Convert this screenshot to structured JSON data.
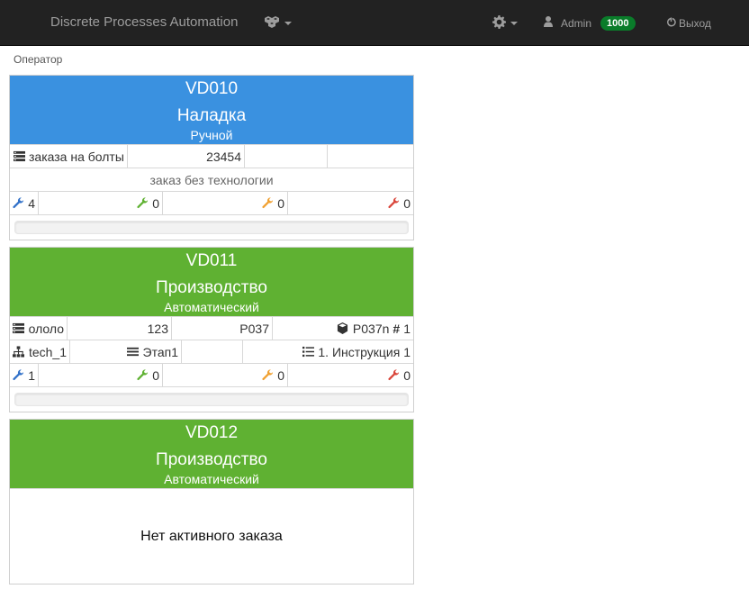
{
  "navbar": {
    "brand": "Discrete Processes Automation",
    "admin_name": "Admin",
    "admin_badge": "1000",
    "logout_label": "Выход"
  },
  "breadcrumb": {
    "label": "Оператор"
  },
  "machines": [
    {
      "id": "VD010",
      "state": "Наладка",
      "mode": "Ручной",
      "header_color": "#3a91e0",
      "order_name": "заказа на болты",
      "order_number": "23454",
      "no_tech_note": "заказ без технологии",
      "tools": {
        "blue": "4",
        "green": "0",
        "orange": "0",
        "red": "0"
      },
      "progress": 0
    },
    {
      "id": "VD011",
      "state": "Производство",
      "mode": "Автоматический",
      "header_color": "#5fb132",
      "order_name": "ололо",
      "order_number": "123",
      "part": "P037",
      "part_n": "P037n",
      "part_count": "1",
      "tech": "tech_1",
      "stage": "Этап1",
      "instruction": "1. Инструкция 1",
      "tools": {
        "blue": "1",
        "green": "0",
        "orange": "0",
        "red": "0"
      },
      "progress": 0
    },
    {
      "id": "VD012",
      "state": "Производство",
      "mode": "Автоматический",
      "header_color": "#5fb132",
      "empty_message": "Нет активного заказа"
    }
  ]
}
